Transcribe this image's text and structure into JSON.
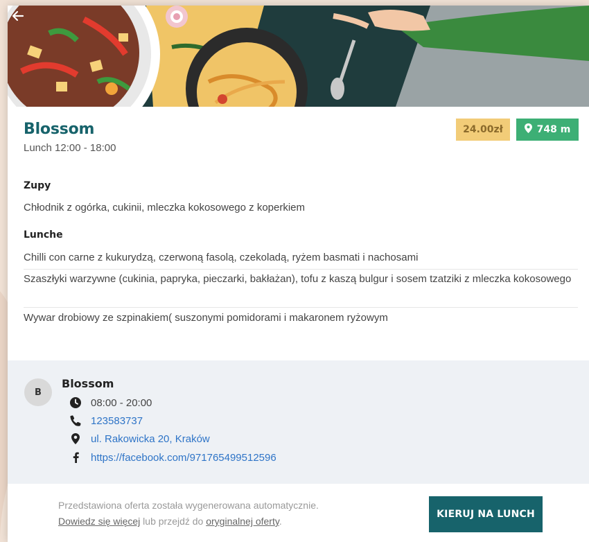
{
  "nav": {
    "back_icon": "arrow-left-icon"
  },
  "restaurant": {
    "name": "Blossom",
    "hours_label": "Lunch 12:00 - 18:00",
    "price": "24.00zł",
    "distance": "748 m",
    "distance_icon": "map-marker-icon"
  },
  "menu": {
    "sections": [
      {
        "title": "Zupy",
        "items": [
          "Chłodnik z ogórka, cukinii, mleczka kokosowego z koperkiem"
        ]
      },
      {
        "title": "Lunche",
        "items": [
          "Chilli con carne z kukurydzą, czerwoną fasolą, czekoladą, ryżem basmati i nachosami",
          "Szaszłyki warzywne (cukinia, papryka, pieczarki, bakłażan), tofu z kaszą bulgur i sosem tzatziki z mleczka kokosowego",
          "Wywar drobiowy ze szpinakiem( suszonymi pomidorami i makaronem ryżowym"
        ]
      }
    ]
  },
  "venue": {
    "avatar_letter": "B",
    "name": "Blossom",
    "opening_hours": "08:00 - 20:00",
    "phone": "123583737",
    "address": "ul. Rakowicka 20, Kraków",
    "facebook": "https://facebook.com/971765499512596",
    "icons": {
      "hours": "clock-icon",
      "phone": "phone-icon",
      "address": "map-marker-icon",
      "facebook": "facebook-icon"
    }
  },
  "footer": {
    "notice": "Przedstawiona oferta została wygenerowana automatycznie.",
    "learn_more_link": "Dowiedz się więcej",
    "middle_text": " lub przejdź do ",
    "original_offer_link": "oryginalnej oferty",
    "end_text": ".",
    "cta_label": "KIERUJ NA LUNCH"
  },
  "colors": {
    "accent": "#17636b",
    "price_badge": "#f2cc78",
    "distance_badge": "#3daf75",
    "link": "#2e74c7"
  }
}
